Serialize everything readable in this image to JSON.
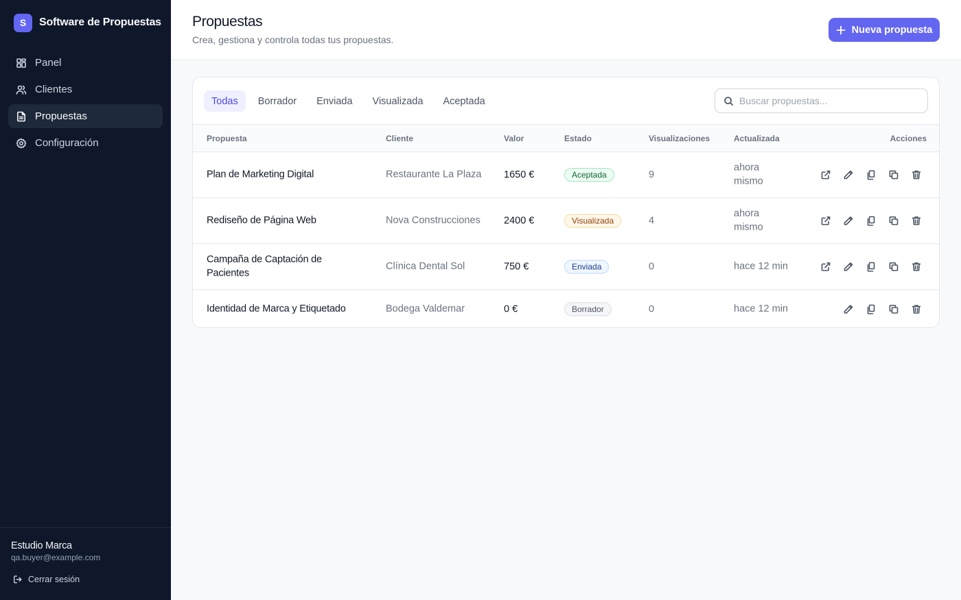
{
  "app": {
    "logo_letter": "S",
    "name": "Software de Propuestas"
  },
  "sidebar": {
    "items": [
      {
        "label": "Panel",
        "icon": "grid-icon"
      },
      {
        "label": "Clientes",
        "icon": "users-icon"
      },
      {
        "label": "Propuestas",
        "icon": "file-text-icon",
        "active": true
      },
      {
        "label": "Configuración",
        "icon": "gear-icon"
      }
    ],
    "user_name": "Estudio Marca",
    "user_email": "qa.buyer@example.com",
    "logout_label": "Cerrar sesión"
  },
  "header": {
    "title": "Propuestas",
    "subtitle": "Crea, gestiona y controla todas tus propuestas.",
    "new_button": "Nueva propuesta"
  },
  "filters": {
    "tabs": [
      "Todas",
      "Borrador",
      "Enviada",
      "Visualizada",
      "Aceptada"
    ],
    "active": "Todas",
    "search_placeholder": "Buscar propuestas..."
  },
  "table": {
    "columns": [
      "Propuesta",
      "Cliente",
      "Valor",
      "Estado",
      "Visualizaciones",
      "Actualizada",
      "Acciones"
    ],
    "rows": [
      {
        "name": "Plan de Marketing Digital",
        "client": "Restaurante La Plaza",
        "value": "1650 €",
        "status": "Aceptada",
        "status_color": "green",
        "views": "9",
        "updated": "ahora mismo"
      },
      {
        "name": "Rediseño de Página Web",
        "client": "Nova Construcciones",
        "value": "2400 €",
        "status": "Visualizada",
        "status_color": "amber",
        "views": "4",
        "updated": "ahora mismo"
      },
      {
        "name": "Campaña de Captación de Pacientes",
        "client": "Clínica Dental Sol",
        "value": "750 €",
        "status": "Enviada",
        "status_color": "blue",
        "views": "0",
        "updated": "hace 12 min"
      },
      {
        "name": "Identidad de Marca y Etiquetado",
        "client": "Bodega Valdemar",
        "value": "0 €",
        "status": "Borrador",
        "status_color": "gray",
        "views": "0",
        "updated": "hace 12 min"
      }
    ],
    "row_actions": [
      "external-link-icon",
      "pencil-icon",
      "copy-icon",
      "duplicate-icon",
      "trash-icon"
    ]
  },
  "colors": {
    "accent": "#6366f1",
    "sidebar_bg": "#0f172a"
  }
}
